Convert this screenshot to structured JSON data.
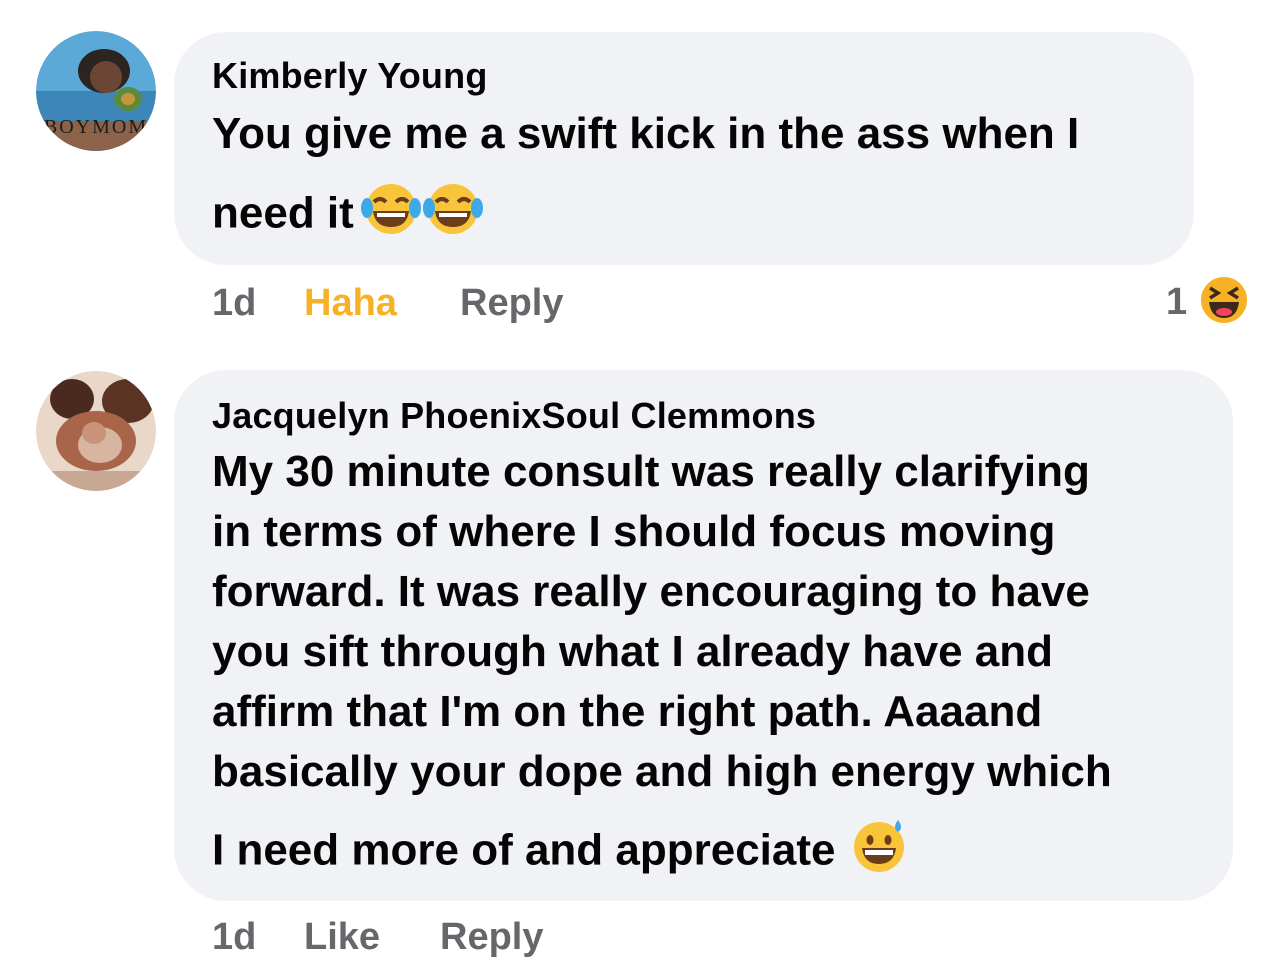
{
  "comments": [
    {
      "author": "Kimberly Young",
      "text_lines": [
        "You give me a swift kick in the ass when I",
        "need it"
      ],
      "emojis": [
        "tears-of-joy-emoji",
        "tears-of-joy-emoji"
      ],
      "avatar_text": "BOYMOM",
      "time": "1d",
      "like_action": "Haha",
      "reply_action": "Reply",
      "reaction_count": "1",
      "reaction_icon": "laughing-squint-emoji"
    },
    {
      "author": "Jacquelyn PhoenixSoul Clemmons",
      "text_lines": [
        "My 30 minute consult was really clarifying",
        "in terms of where I should focus moving",
        "forward. It was really encouraging to have",
        "you sift through what I already have and",
        "affirm that I'm on the right path. Aaaand",
        "basically your dope and high energy which",
        "I need more of and appreciate"
      ],
      "emojis": [
        "grinning-sweat-emoji"
      ],
      "time": "1d",
      "like_action": "Like",
      "reply_action": "Reply"
    }
  ],
  "colors": {
    "bubble": "#f0f2f5",
    "meta_text": "#65676b",
    "haha_active": "#f7b125"
  }
}
